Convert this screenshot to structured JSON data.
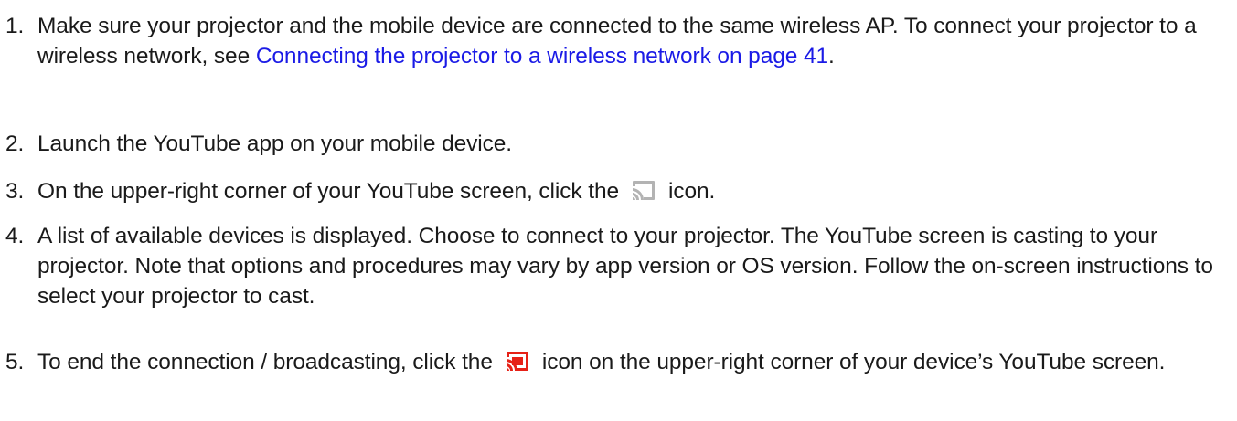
{
  "steps": [
    {
      "number": "1.",
      "text_before": "Make sure your projector and the mobile device are connected to the same wireless AP. To connect your projector to a wireless network, see ",
      "link": "Connecting the projector to a wireless network on page 41",
      "text_after": "."
    },
    {
      "number": "2.",
      "text": "Launch the YouTube app on your mobile device."
    },
    {
      "number": "3.",
      "text_before": "On the upper-right corner of your YouTube screen, click the",
      "icon": "cast-icon-gray",
      "text_after": "icon."
    },
    {
      "number": "4.",
      "text": "A list of available devices is displayed. Choose to connect to your projector. The YouTube screen is casting to your projector. Note that options and procedures may vary by app version or OS version. Follow the on-screen instructions to select your projector to cast."
    },
    {
      "number": "5.",
      "text_before": "To end the connection / broadcasting, click the",
      "icon": "cast-icon-red",
      "text_after": "icon on the upper-right corner of your device’s YouTube screen."
    }
  ],
  "colors": {
    "text": "#1a1a1a",
    "link": "#1a1ae6",
    "cast_inactive": "#b3b3b3",
    "cast_active": "#e62117"
  }
}
